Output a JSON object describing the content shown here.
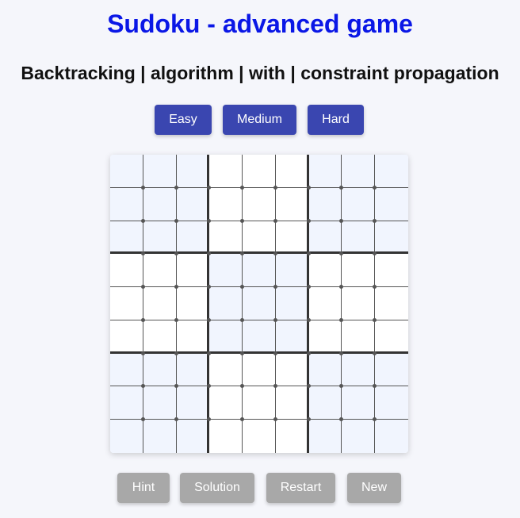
{
  "header": {
    "title": "Sudoku - advanced game",
    "subtitle": "Backtracking | algorithm | with | constraint propagation"
  },
  "difficulty": {
    "easy_label": "Easy",
    "medium_label": "Medium",
    "hard_label": "Hard"
  },
  "actions": {
    "hint_label": "Hint",
    "solution_label": "Solution",
    "restart_label": "Restart",
    "new_label": "New"
  },
  "board": {
    "size": 9,
    "values": [
      [
        "",
        "",
        "",
        "",
        "",
        "",
        "",
        "",
        ""
      ],
      [
        "",
        "",
        "",
        "",
        "",
        "",
        "",
        "",
        ""
      ],
      [
        "",
        "",
        "",
        "",
        "",
        "",
        "",
        "",
        ""
      ],
      [
        "",
        "",
        "",
        "",
        "",
        "",
        "",
        "",
        ""
      ],
      [
        "",
        "",
        "",
        "",
        "",
        "",
        "",
        "",
        ""
      ],
      [
        "",
        "",
        "",
        "",
        "",
        "",
        "",
        "",
        ""
      ],
      [
        "",
        "",
        "",
        "",
        "",
        "",
        "",
        "",
        ""
      ],
      [
        "",
        "",
        "",
        "",
        "",
        "",
        "",
        "",
        ""
      ],
      [
        "",
        "",
        "",
        "",
        "",
        "",
        "",
        "",
        ""
      ]
    ]
  },
  "colors": {
    "title": "#0a17e6",
    "difficulty_button": "#3a46b0",
    "action_button": "#a8a8a8",
    "shaded_cell": "#f1f5fe",
    "plain_cell": "#ffffff",
    "background": "#f5f6fb"
  }
}
